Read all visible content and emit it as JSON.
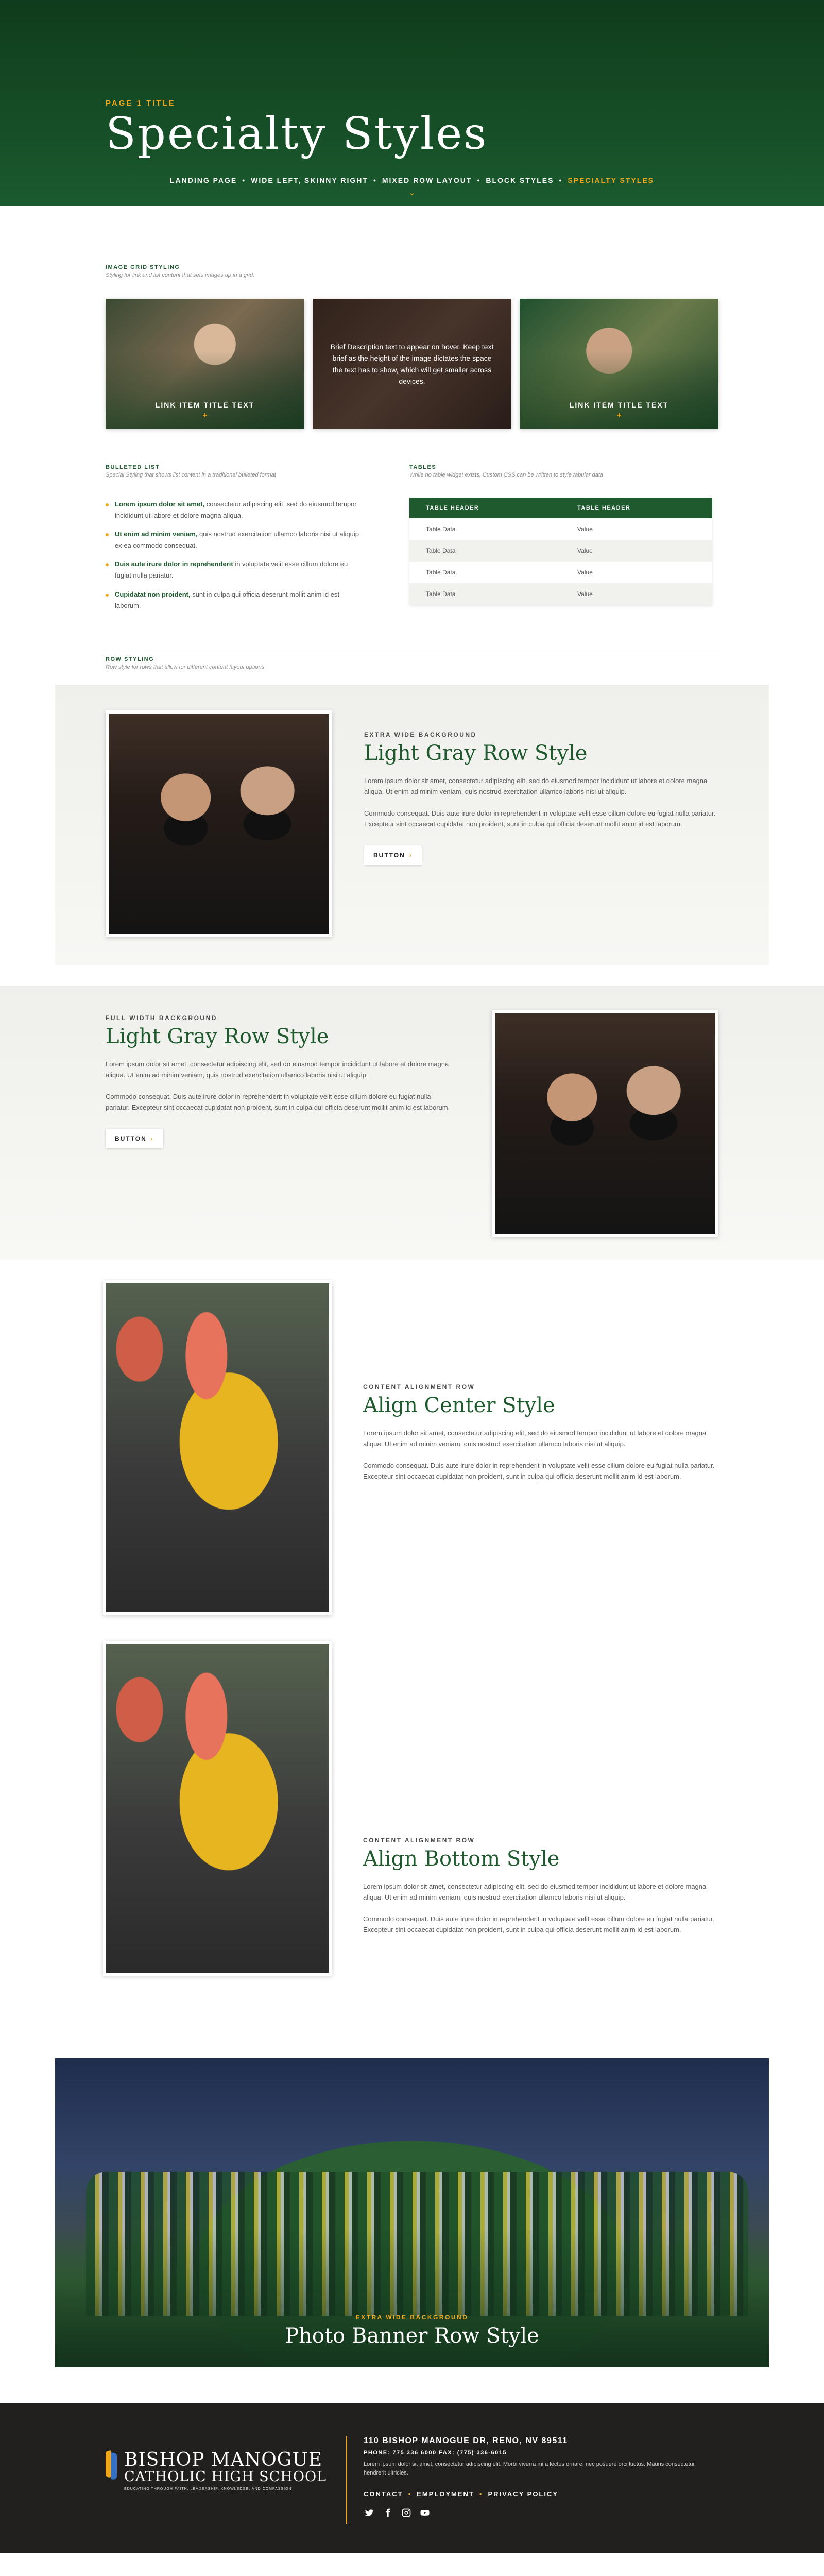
{
  "hero": {
    "eyebrow": "Page 1 Title",
    "title": "Specialty Styles",
    "nav": [
      {
        "label": "LANDING PAGE",
        "active": false
      },
      {
        "label": "WIDE LEFT, SKINNY RIGHT",
        "active": false
      },
      {
        "label": "MIXED ROW LAYOUT",
        "active": false
      },
      {
        "label": "BLOCK STYLES",
        "active": false
      },
      {
        "label": "SPECIALTY STYLES",
        "active": true
      }
    ]
  },
  "image_grid": {
    "label": "IMAGE GRID STYLING",
    "sub": "Styling for link and list content that sets images up in a grid.",
    "tiles": [
      {
        "label": "LINK ITEM TITLE TEXT",
        "plus": "+"
      },
      {
        "desc": "Brief Description text to appear on hover. Keep text brief as the height of the image dictates the space the text has to show, which will get smaller across devices."
      },
      {
        "label": "LINK ITEM TITLE TEXT",
        "plus": "+"
      }
    ]
  },
  "bulleted": {
    "label": "BULLETED LIST",
    "sub": "Special Styling that shows list content in a traditional bulleted format",
    "items": [
      {
        "bold": "Lorem ipsum dolor sit amet,",
        "text": " consectetur adipiscing elit, sed do eiusmod tempor incididunt ut labore et dolore magna aliqua."
      },
      {
        "bold": "Ut enim ad minim veniam,",
        "text": " quis nostrud exercitation ullamco laboris nisi ut aliquip ex ea commodo consequat."
      },
      {
        "bold": "Duis aute irure dolor in reprehenderit",
        "text": " in voluptate velit esse cillum dolore eu fugiat nulla pariatur."
      },
      {
        "bold": "Cupidatat non proident,",
        "text": " sunt in culpa qui officia deserunt mollit anim id est laborum."
      }
    ]
  },
  "tables": {
    "label": "TABLES",
    "sub": "While no table widget exists, Custom CSS can be written to style tabular data",
    "headers": [
      "TABLE HEADER",
      "TABLE HEADER"
    ],
    "rows": [
      [
        "Table Data",
        "Value"
      ],
      [
        "Table Data",
        "Value"
      ],
      [
        "Table Data",
        "Value"
      ],
      [
        "Table Data",
        "Value"
      ]
    ]
  },
  "row_styling": {
    "label": "ROW STYLING",
    "sub": "Row style for rows that allow for different content layout options"
  },
  "rows": {
    "extra_wide": {
      "eyebrow": "EXTRA WIDE BACKGROUND",
      "title": "Light Gray Row Style",
      "p1": "Lorem ipsum dolor sit amet, consectetur adipiscing elit, sed do eiusmod tempor incididunt ut labore et dolore magna aliqua. Ut enim ad minim veniam, quis nostrud exercitation ullamco laboris nisi ut aliquip.",
      "p2": "Commodo consequat. Duis aute irure dolor in reprehenderit in voluptate velit esse cillum dolore eu fugiat nulla pariatur. Excepteur sint occaecat cupidatat non proident, sunt in culpa qui officia deserunt mollit anim id est laborum.",
      "button": "BUTTON"
    },
    "full_width": {
      "eyebrow": "FULL WIDTH BACKGROUND",
      "title": "Light Gray Row Style",
      "p1": "Lorem ipsum dolor sit amet, consectetur adipiscing elit, sed do eiusmod tempor incididunt ut labore et dolore magna aliqua. Ut enim ad minim veniam, quis nostrud exercitation ullamco laboris nisi ut aliquip.",
      "p2": "Commodo consequat. Duis aute irure dolor in reprehenderit in voluptate velit esse cillum dolore eu fugiat nulla pariatur. Excepteur sint occaecat cupidatat non proident, sunt in culpa qui officia deserunt mollit anim id est laborum.",
      "button": "BUTTON"
    },
    "align_center": {
      "eyebrow": "CONTENT ALIGNMENT ROW",
      "title": "Align Center Style",
      "p1": "Lorem ipsum dolor sit amet, consectetur adipiscing elit, sed do eiusmod tempor incididunt ut labore et dolore magna aliqua. Ut enim ad minim veniam, quis nostrud exercitation ullamco laboris nisi ut aliquip.",
      "p2": "Commodo consequat. Duis aute irure dolor in reprehenderit in voluptate velit esse cillum dolore eu fugiat nulla pariatur. Excepteur sint occaecat cupidatat non proident, sunt in culpa qui officia deserunt mollit anim id est laborum."
    },
    "align_bottom": {
      "eyebrow": "CONTENT ALIGNMENT ROW",
      "title": "Align Bottom Style",
      "p1": "Lorem ipsum dolor sit amet, consectetur adipiscing elit, sed do eiusmod tempor incididunt ut labore et dolore magna aliqua. Ut enim ad minim veniam, quis nostrud exercitation ullamco laboris nisi ut aliquip.",
      "p2": "Commodo consequat. Duis aute irure dolor in reprehenderit in voluptate velit esse cillum dolore eu fugiat nulla pariatur. Excepteur sint occaecat cupidatat non proident, sunt in culpa qui officia deserunt mollit anim id est laborum."
    },
    "banner": {
      "eyebrow": "EXTRA WIDE BACKGROUND",
      "title": "Photo Banner Row Style"
    }
  },
  "footer": {
    "logo_name": "BISHOP MANOGUE",
    "logo_sub": "CATHOLIC HIGH SCHOOL",
    "logo_tag": "EDUCATING THROUGH FAITH, LEADERSHIP, KNOWLEDGE, AND COMPASSION",
    "address": "110 BISHOP MANOGUE DR, RENO, NV 89511",
    "phone": "PHONE: 775 336 6000     FAX: (775) 336-6015",
    "fine": "Lorem ipsum dolor sit amet, consectetur adipiscing elit. Morbi viverra mi a lectus ornare, nec posuere orci luctus. Mauris consectetur hendrerit ultricies.",
    "links": [
      "CONTACT",
      "EMPLOYMENT",
      "PRIVACY POLICY"
    ],
    "socials": [
      "twitter-icon",
      "facebook-icon",
      "instagram-icon",
      "youtube-icon"
    ]
  },
  "colors": {
    "brand_green": "#1e5a2e",
    "accent_gold": "#f2a71b",
    "footer_bg": "#221f1f"
  }
}
